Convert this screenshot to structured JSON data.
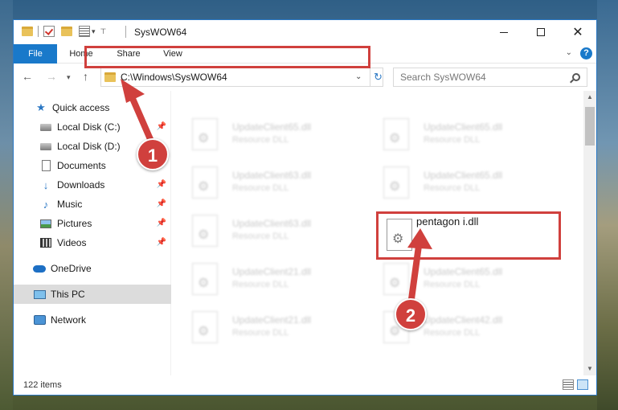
{
  "window": {
    "title": "SysWOW64"
  },
  "ribbon": {
    "tabs": [
      "File",
      "Home",
      "Share",
      "View"
    ]
  },
  "navigation": {
    "address": "C:\\Windows\\SysWOW64",
    "search_placeholder": "Search SysWOW64"
  },
  "sidebar": {
    "items": [
      {
        "label": "Quick access"
      },
      {
        "label": "Local Disk (C:)"
      },
      {
        "label": "Local Disk (D:)"
      },
      {
        "label": "Documents"
      },
      {
        "label": "Downloads"
      },
      {
        "label": "Music"
      },
      {
        "label": "Pictures"
      },
      {
        "label": "Videos"
      },
      {
        "label": "OneDrive"
      },
      {
        "label": "This PC"
      },
      {
        "label": "Network"
      }
    ]
  },
  "files": [
    {
      "name": "UpdateClient65.dll",
      "type": "Resource DLL"
    },
    {
      "name": "UpdateClient65.dll",
      "type": "Resource DLL"
    },
    {
      "name": "UpdateClient63.dll",
      "type": "Resource DLL"
    },
    {
      "name": "UpdateClient65.dll",
      "type": "Resource DLL"
    },
    {
      "name": "UpdateClient63.dll",
      "type": "Resource DLL"
    },
    {
      "name": "pentagon i.dll",
      "type": ""
    },
    {
      "name": "UpdateClient21.dll",
      "type": "Resource DLL"
    },
    {
      "name": "UpdateClient65.dll",
      "type": "Resource DLL"
    },
    {
      "name": "UpdateClient21.dll",
      "type": "Resource DLL"
    },
    {
      "name": "UpdateClient42.dll",
      "type": "Resource DLL"
    }
  ],
  "status": {
    "item_count": "122 items"
  },
  "annotations": {
    "step1": "1",
    "step2": "2"
  },
  "icons": {
    "help": "?",
    "accent": "#1979ca",
    "annotation_color": "#d0403d"
  }
}
